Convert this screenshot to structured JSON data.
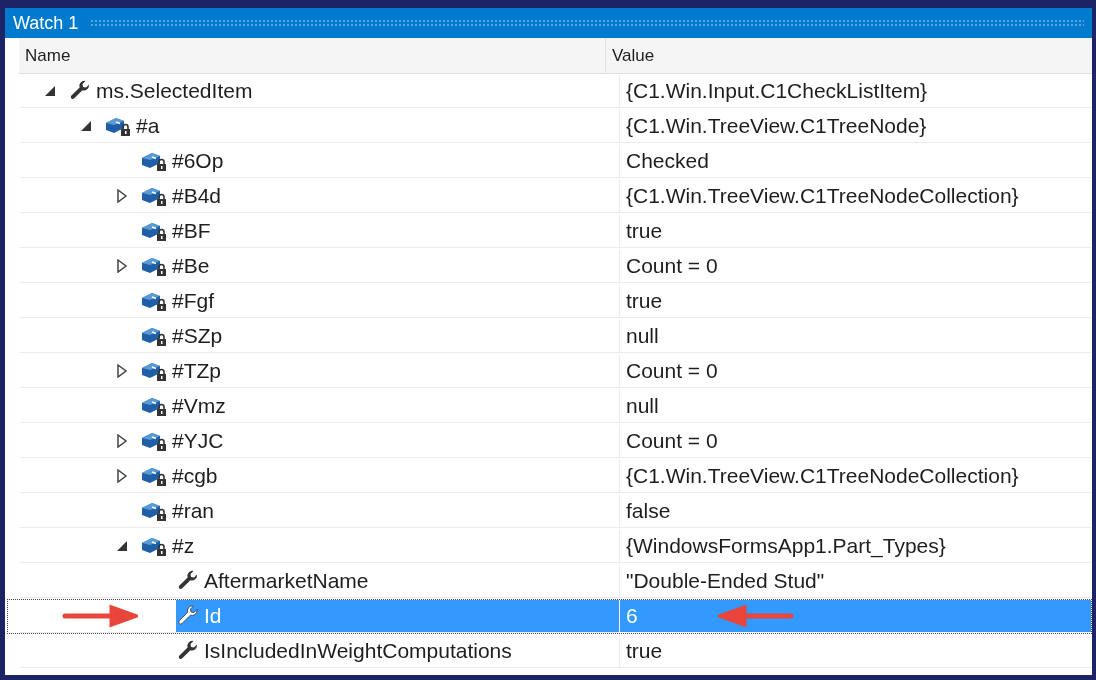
{
  "window": {
    "title": "Watch 1"
  },
  "columns": [
    "Name",
    "Value"
  ],
  "rows": [
    {
      "name": "ms.SelectedItem",
      "value": "{C1.Win.Input.C1CheckListItem}",
      "kind": "property",
      "expanded": true,
      "selected": false,
      "children": [
        {
          "name": "#a",
          "value": "{C1.Win.TreeView.C1TreeNode}",
          "kind": "field",
          "expanded": true,
          "selected": false,
          "children": [
            {
              "name": "#6Op",
              "value": "Checked",
              "kind": "field",
              "selected": false
            },
            {
              "name": "#B4d",
              "value": "{C1.Win.TreeView.C1TreeNodeCollection}",
              "kind": "field",
              "expanded": false,
              "selected": false
            },
            {
              "name": "#BF",
              "value": "true",
              "kind": "field",
              "selected": false
            },
            {
              "name": "#Be",
              "value": "Count = 0",
              "kind": "field",
              "expanded": false,
              "selected": false
            },
            {
              "name": "#Fgf",
              "value": "true",
              "kind": "field",
              "selected": false
            },
            {
              "name": "#SZp",
              "value": "null",
              "kind": "field",
              "selected": false
            },
            {
              "name": "#TZp",
              "value": "Count = 0",
              "kind": "field",
              "expanded": false,
              "selected": false
            },
            {
              "name": "#Vmz",
              "value": "null",
              "kind": "field",
              "selected": false
            },
            {
              "name": "#YJC",
              "value": "Count = 0",
              "kind": "field",
              "expanded": false,
              "selected": false
            },
            {
              "name": "#cgb",
              "value": "{C1.Win.TreeView.C1TreeNodeCollection}",
              "kind": "field",
              "expanded": false,
              "selected": false
            },
            {
              "name": "#ran",
              "value": "false",
              "kind": "field",
              "selected": false
            },
            {
              "name": "#z",
              "value": "{WindowsFormsApp1.Part_Types}",
              "kind": "field",
              "expanded": true,
              "selected": false,
              "children": [
                {
                  "name": "AftermarketName",
                  "value": "\"Double-Ended Stud\"",
                  "kind": "property",
                  "selected": false
                },
                {
                  "name": "Id",
                  "value": "6",
                  "kind": "property",
                  "selected": true
                },
                {
                  "name": "IsIncludedInWeightComputations",
                  "value": "true",
                  "kind": "property",
                  "selected": false
                }
              ]
            }
          ]
        }
      ]
    }
  ]
}
